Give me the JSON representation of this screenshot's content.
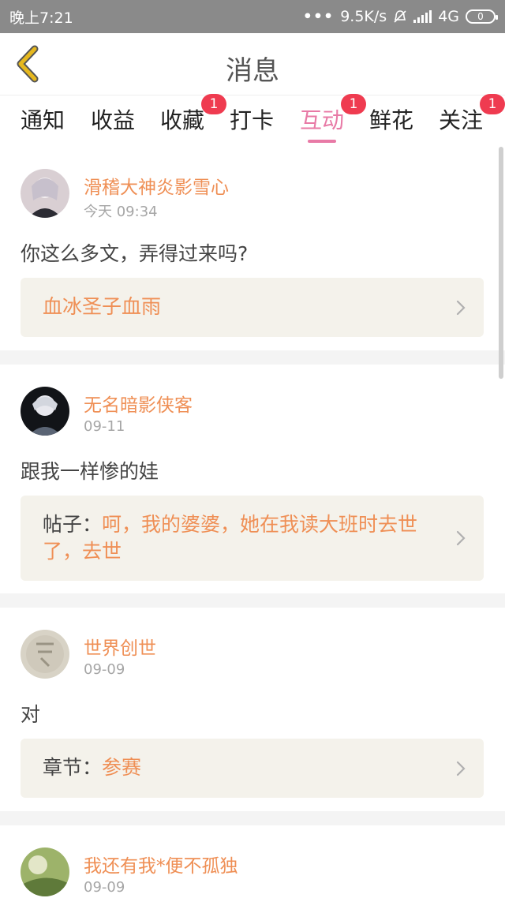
{
  "status_bar": {
    "time": "晚上7:21",
    "dots": "•••",
    "speed": "9.5K/s",
    "network": "4G",
    "battery": "0",
    "icons": [
      "mute-icon",
      "signal-icon",
      "battery-icon"
    ]
  },
  "header": {
    "title": "消息",
    "back_icon": "chevron-left-icon"
  },
  "tabs": [
    {
      "label": "通知"
    },
    {
      "label": "收益"
    },
    {
      "label": "收藏",
      "badge": "1"
    },
    {
      "label": "打卡"
    },
    {
      "label": "互动",
      "badge": "1",
      "active": true
    },
    {
      "label": "鲜花"
    },
    {
      "label": "关注",
      "badge": "1"
    }
  ],
  "messages": [
    {
      "user": "滑稽大神炎影雪心",
      "time": "今天 09:34",
      "text": "你这么多文，弄得过来吗?",
      "ref_label": "",
      "ref_text": "血冰圣子血雨"
    },
    {
      "user": "无名暗影侠客",
      "time": "09-11",
      "text": "跟我一样惨的娃",
      "ref_label": "帖子：",
      "ref_text": "呵，我的婆婆，她在我读大班时去世了，去世"
    },
    {
      "user": "世界创世",
      "time": "09-09",
      "text": "对",
      "ref_label": "章节：",
      "ref_text": "参赛"
    },
    {
      "user": "我还有我*便不孤独",
      "time": "09-09"
    }
  ],
  "colors": {
    "accent": "#e87aa6",
    "username": "#ef8f55",
    "badge": "#ef3b50",
    "status_bar": "#8a8a8a",
    "back_arrow": "#e6b81e"
  }
}
